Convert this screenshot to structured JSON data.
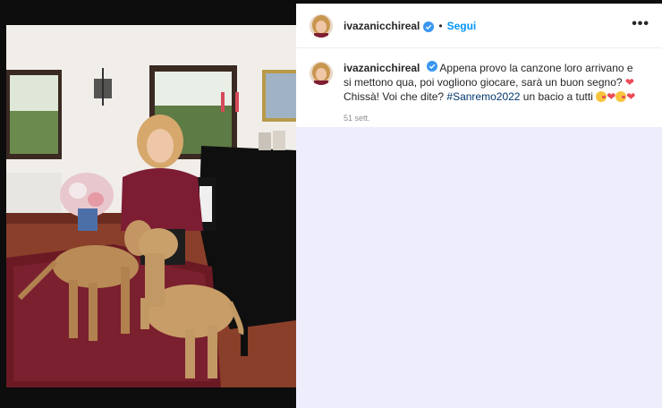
{
  "post": {
    "username": "ivazanicchireal",
    "follow_label": "Segui",
    "separator": "•",
    "more_label": "•••",
    "caption_part1": " Appena provo la canzone loro arrivano e si mettono qua, poi vogliono giocare, sarà un buon segno? ",
    "heart1": "❤",
    "caption_part2": " Chissà! Voi che dite? ",
    "hashtag": "#Sanremo2022",
    "caption_part3": " un bacio a tutti ",
    "trailing_hearts": "❤",
    "timestamp": "51 sett."
  },
  "icons": {
    "verified": "verified-badge-icon",
    "more": "more-options-icon",
    "emoji_kiss": "face-blowing-kiss-icon",
    "heart": "red-heart-icon"
  },
  "colors": {
    "follow_blue": "#0095f6",
    "verified_blue": "#3897f0",
    "hashtag": "#00376b",
    "heart_red": "#ed4956",
    "panel_lower": "#eeedfb",
    "frame_black": "#0d0d0d"
  }
}
